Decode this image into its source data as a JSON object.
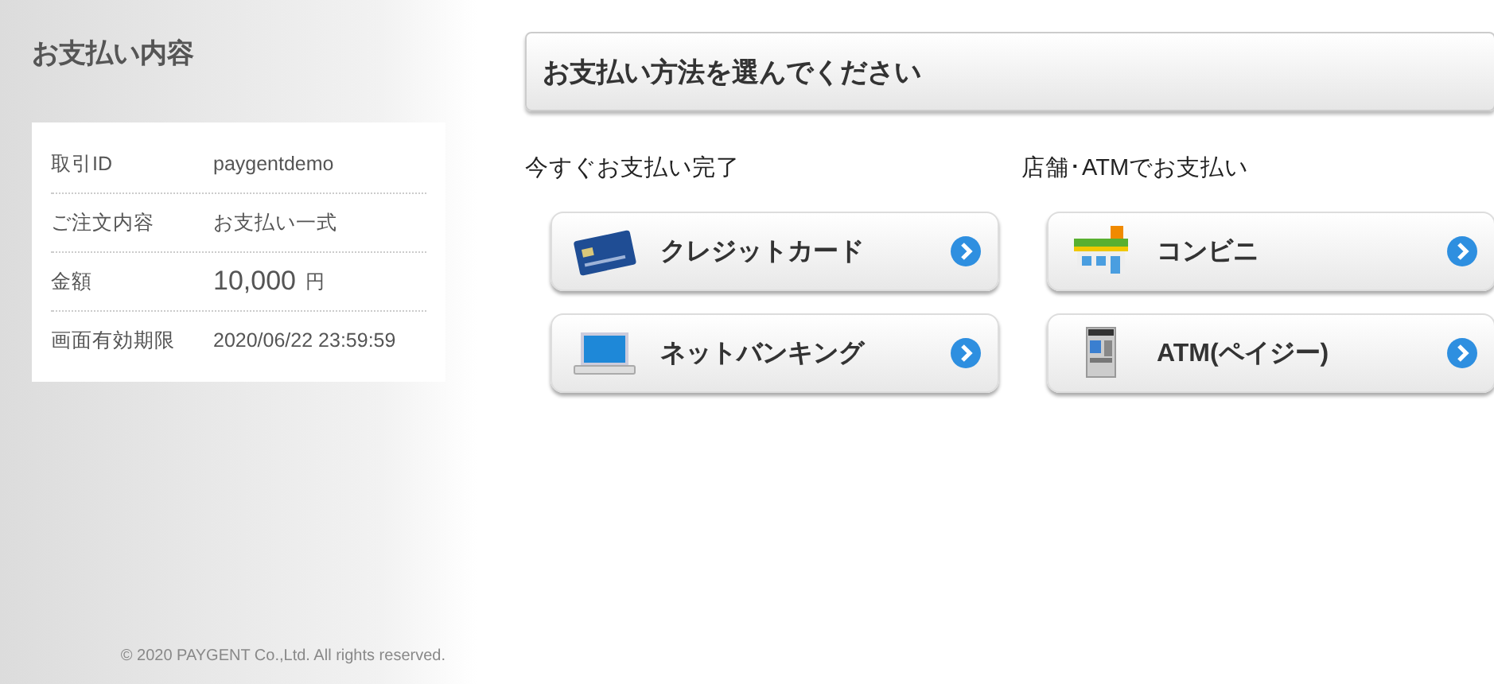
{
  "sidebar": {
    "title": "お支払い内容",
    "details": [
      {
        "label": "取引ID",
        "value": "paygentdemo"
      },
      {
        "label": "ご注文内容",
        "value": "お支払い一式"
      },
      {
        "label": "金額",
        "value": "10,000",
        "unit": "円",
        "kind": "amount"
      },
      {
        "label": "画面有効期限",
        "value": "2020/06/22 23:59:59"
      }
    ],
    "copyright": "© 2020 PAYGENT Co.,Ltd. All rights reserved."
  },
  "main": {
    "title": "お支払い方法を選んでください",
    "groups": [
      {
        "heading": "今すぐお支払い完了",
        "methods": [
          {
            "label": "クレジットカード",
            "kind": "card"
          },
          {
            "label": "ネットバンキング",
            "kind": "laptop"
          }
        ]
      },
      {
        "heading": "店舗･ATMでお支払い",
        "methods": [
          {
            "label": "コンビニ",
            "kind": "store"
          },
          {
            "label": "ATM(ペイジー)",
            "kind": "atm"
          }
        ]
      }
    ]
  }
}
